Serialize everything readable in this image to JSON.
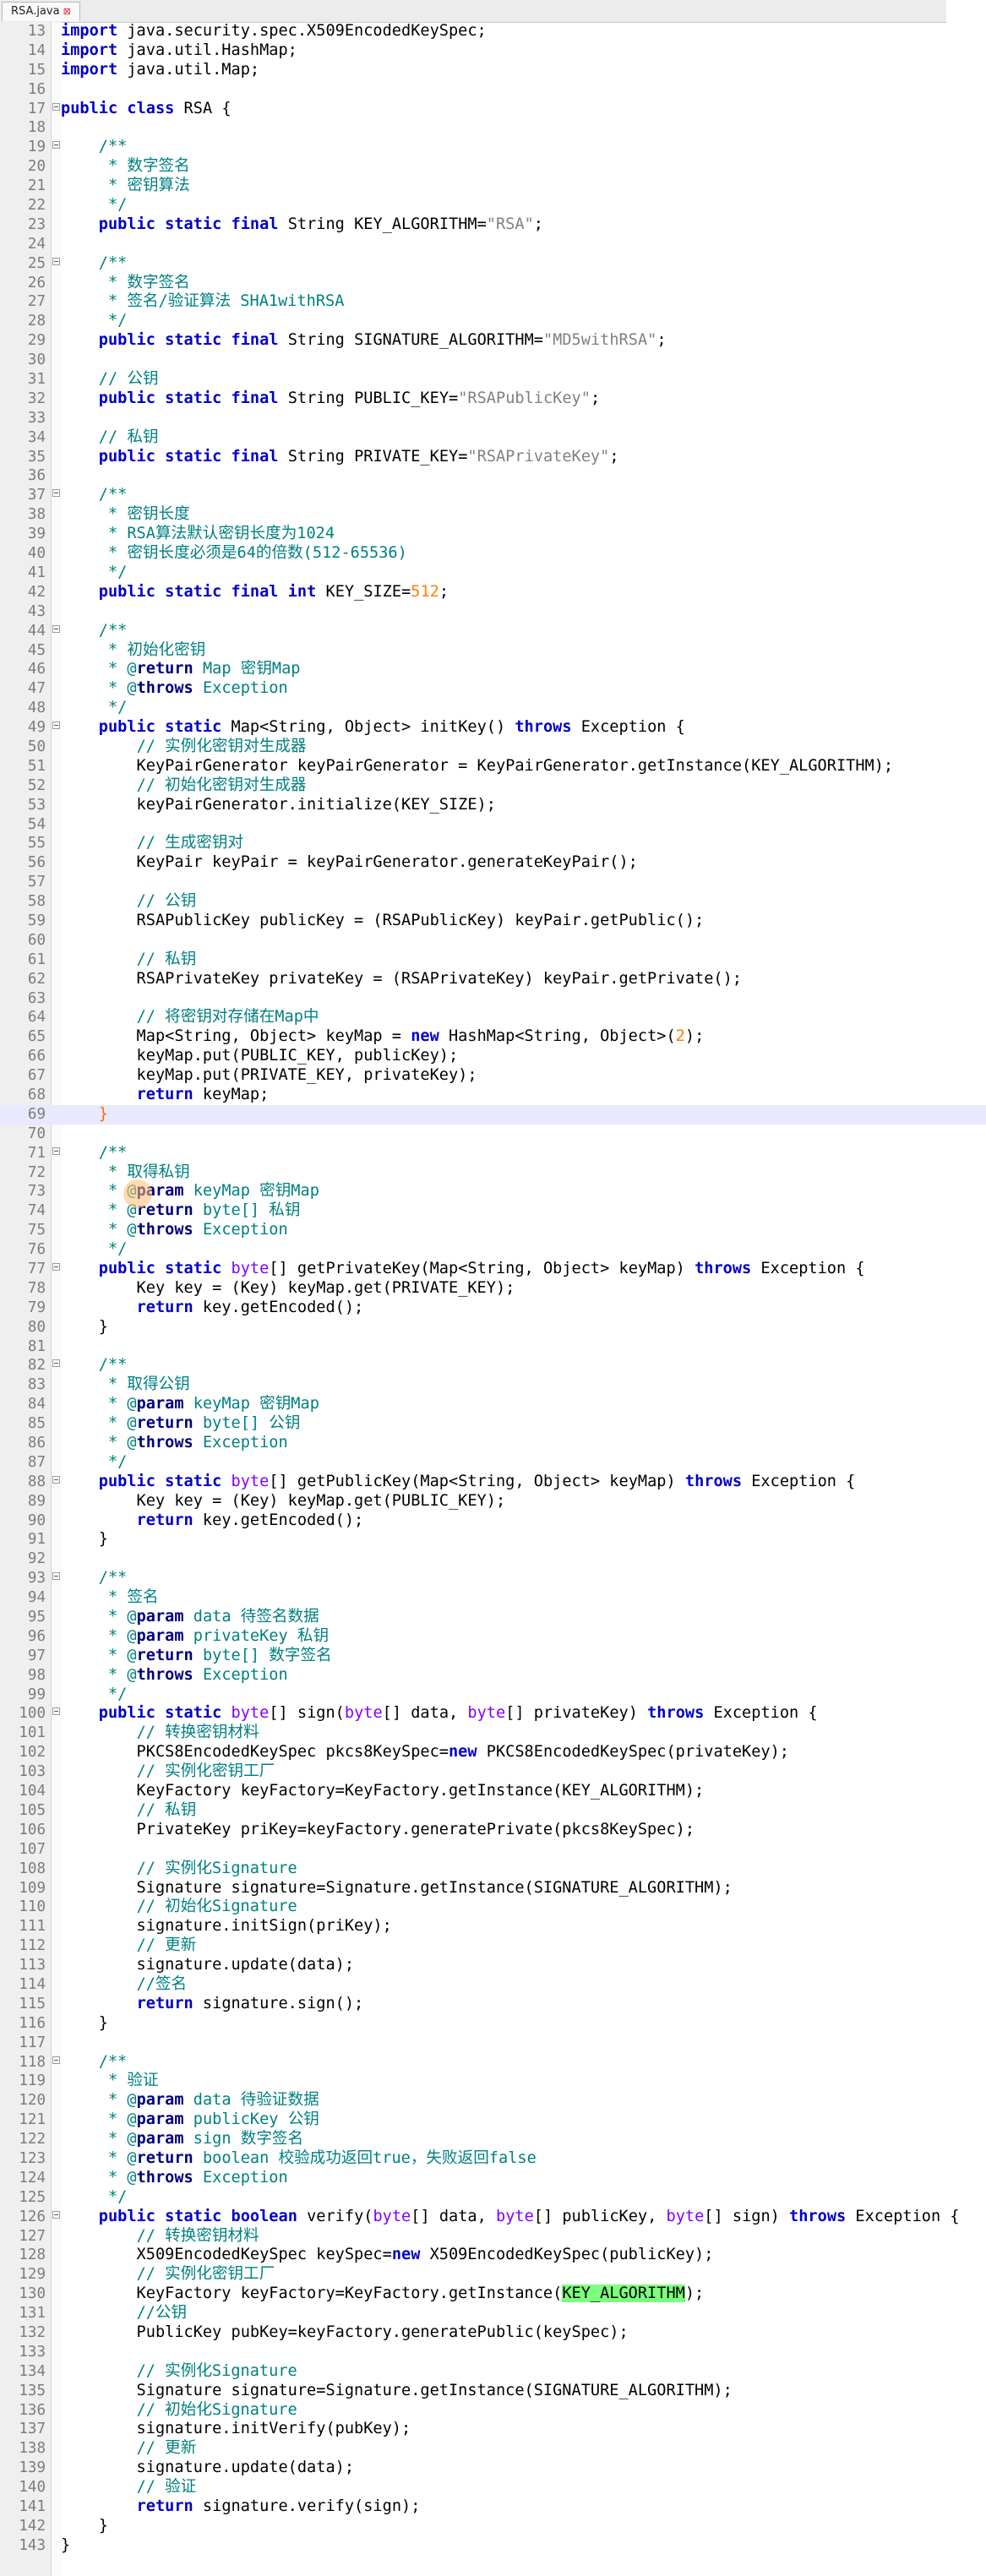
{
  "tab": {
    "label": "RSA.java",
    "close_glyph": "⊠"
  },
  "colors": {
    "keyword": "#0000c8",
    "comment": "#008080",
    "string": "#808080",
    "number": "#ff8000",
    "type": "#8000ff",
    "highlight": "#7cff7c",
    "current_line": "#e8e8ff"
  },
  "lines": [
    {
      "n": "13",
      "t": "import java.security.spec.X509EncodedKeySpec;"
    },
    {
      "n": "14",
      "t": "import java.util.HashMap;"
    },
    {
      "n": "15",
      "t": "import java.util.Map;"
    },
    {
      "n": "16",
      "t": ""
    },
    {
      "n": "17",
      "t": "public class RSA {",
      "fold": true
    },
    {
      "n": "18",
      "t": ""
    },
    {
      "n": "19",
      "t": "    /**",
      "fold": true
    },
    {
      "n": "20",
      "t": "     * 数字签名"
    },
    {
      "n": "21",
      "t": "     * 密钥算法"
    },
    {
      "n": "22",
      "t": "     */"
    },
    {
      "n": "23",
      "t": "    public static final String KEY_ALGORITHM=\"RSA\";"
    },
    {
      "n": "24",
      "t": ""
    },
    {
      "n": "25",
      "t": "    /**",
      "fold": true
    },
    {
      "n": "26",
      "t": "     * 数字签名"
    },
    {
      "n": "27",
      "t": "     * 签名/验证算法 SHA1withRSA"
    },
    {
      "n": "28",
      "t": "     */"
    },
    {
      "n": "29",
      "t": "    public static final String SIGNATURE_ALGORITHM=\"MD5withRSA\";"
    },
    {
      "n": "30",
      "t": ""
    },
    {
      "n": "31",
      "t": "    // 公钥"
    },
    {
      "n": "32",
      "t": "    public static final String PUBLIC_KEY=\"RSAPublicKey\";"
    },
    {
      "n": "33",
      "t": ""
    },
    {
      "n": "34",
      "t": "    // 私钥"
    },
    {
      "n": "35",
      "t": "    public static final String PRIVATE_KEY=\"RSAPrivateKey\";"
    },
    {
      "n": "36",
      "t": ""
    },
    {
      "n": "37",
      "t": "    /**",
      "fold": true
    },
    {
      "n": "38",
      "t": "     * 密钥长度"
    },
    {
      "n": "39",
      "t": "     * RSA算法默认密钥长度为1024"
    },
    {
      "n": "40",
      "t": "     * 密钥长度必须是64的倍数(512-65536)"
    },
    {
      "n": "41",
      "t": "     */"
    },
    {
      "n": "42",
      "t": "    public static final int KEY_SIZE=512;"
    },
    {
      "n": "43",
      "t": ""
    },
    {
      "n": "44",
      "t": "    /**",
      "fold": true
    },
    {
      "n": "45",
      "t": "     * 初始化密钥"
    },
    {
      "n": "46",
      "t": "     * @return Map 密钥Map"
    },
    {
      "n": "47",
      "t": "     * @throws Exception"
    },
    {
      "n": "48",
      "t": "     */"
    },
    {
      "n": "49",
      "t": "    public static Map<String, Object> initKey() throws Exception {",
      "fold": true
    },
    {
      "n": "50",
      "t": "        // 实例化密钥对生成器"
    },
    {
      "n": "51",
      "t": "        KeyPairGenerator keyPairGenerator = KeyPairGenerator.getInstance(KEY_ALGORITHM);"
    },
    {
      "n": "52",
      "t": "        // 初始化密钥对生成器"
    },
    {
      "n": "53",
      "t": "        keyPairGenerator.initialize(KEY_SIZE);"
    },
    {
      "n": "54",
      "t": ""
    },
    {
      "n": "55",
      "t": "        // 生成密钥对"
    },
    {
      "n": "56",
      "t": "        KeyPair keyPair = keyPairGenerator.generateKeyPair();"
    },
    {
      "n": "57",
      "t": ""
    },
    {
      "n": "58",
      "t": "        // 公钥"
    },
    {
      "n": "59",
      "t": "        RSAPublicKey publicKey = (RSAPublicKey) keyPair.getPublic();"
    },
    {
      "n": "60",
      "t": ""
    },
    {
      "n": "61",
      "t": "        // 私钥"
    },
    {
      "n": "62",
      "t": "        RSAPrivateKey privateKey = (RSAPrivateKey) keyPair.getPrivate();"
    },
    {
      "n": "63",
      "t": ""
    },
    {
      "n": "64",
      "t": "        // 将密钥对存储在Map中"
    },
    {
      "n": "65",
      "t": "        Map<String, Object> keyMap = new HashMap<String, Object>(2);"
    },
    {
      "n": "66",
      "t": "        keyMap.put(PUBLIC_KEY, publicKey);"
    },
    {
      "n": "67",
      "t": "        keyMap.put(PRIVATE_KEY, privateKey);"
    },
    {
      "n": "68",
      "t": "        return keyMap;"
    },
    {
      "n": "69",
      "t": "    }",
      "current": true
    },
    {
      "n": "70",
      "t": ""
    },
    {
      "n": "71",
      "t": "    /**",
      "fold": true
    },
    {
      "n": "72",
      "t": "     * 取得私钥"
    },
    {
      "n": "73",
      "t": "     * @param keyMap 密钥Map"
    },
    {
      "n": "74",
      "t": "     * @return byte[] 私钥"
    },
    {
      "n": "75",
      "t": "     * @throws Exception"
    },
    {
      "n": "76",
      "t": "     */"
    },
    {
      "n": "77",
      "t": "    public static byte[] getPrivateKey(Map<String, Object> keyMap) throws Exception {",
      "fold": true
    },
    {
      "n": "78",
      "t": "        Key key = (Key) keyMap.get(PRIVATE_KEY);"
    },
    {
      "n": "79",
      "t": "        return key.getEncoded();"
    },
    {
      "n": "80",
      "t": "    }"
    },
    {
      "n": "81",
      "t": ""
    },
    {
      "n": "82",
      "t": "    /**",
      "fold": true
    },
    {
      "n": "83",
      "t": "     * 取得公钥"
    },
    {
      "n": "84",
      "t": "     * @param keyMap 密钥Map"
    },
    {
      "n": "85",
      "t": "     * @return byte[] 公钥"
    },
    {
      "n": "86",
      "t": "     * @throws Exception"
    },
    {
      "n": "87",
      "t": "     */"
    },
    {
      "n": "88",
      "t": "    public static byte[] getPublicKey(Map<String, Object> keyMap) throws Exception {",
      "fold": true
    },
    {
      "n": "89",
      "t": "        Key key = (Key) keyMap.get(PUBLIC_KEY);"
    },
    {
      "n": "90",
      "t": "        return key.getEncoded();"
    },
    {
      "n": "91",
      "t": "    }"
    },
    {
      "n": "92",
      "t": ""
    },
    {
      "n": "93",
      "t": "    /**",
      "fold": true
    },
    {
      "n": "94",
      "t": "     * 签名"
    },
    {
      "n": "95",
      "t": "     * @param data 待签名数据"
    },
    {
      "n": "96",
      "t": "     * @param privateKey 私钥"
    },
    {
      "n": "97",
      "t": "     * @return byte[] 数字签名"
    },
    {
      "n": "98",
      "t": "     * @throws Exception"
    },
    {
      "n": "99",
      "t": "     */"
    },
    {
      "n": "100",
      "t": "    public static byte[] sign(byte[] data, byte[] privateKey) throws Exception {",
      "fold": true
    },
    {
      "n": "101",
      "t": "        // 转换密钥材料"
    },
    {
      "n": "102",
      "t": "        PKCS8EncodedKeySpec pkcs8KeySpec=new PKCS8EncodedKeySpec(privateKey);"
    },
    {
      "n": "103",
      "t": "        // 实例化密钥工厂"
    },
    {
      "n": "104",
      "t": "        KeyFactory keyFactory=KeyFactory.getInstance(KEY_ALGORITHM);"
    },
    {
      "n": "105",
      "t": "        // 私钥"
    },
    {
      "n": "106",
      "t": "        PrivateKey priKey=keyFactory.generatePrivate(pkcs8KeySpec);"
    },
    {
      "n": "107",
      "t": ""
    },
    {
      "n": "108",
      "t": "        // 实例化Signature"
    },
    {
      "n": "109",
      "t": "        Signature signature=Signature.getInstance(SIGNATURE_ALGORITHM);"
    },
    {
      "n": "110",
      "t": "        // 初始化Signature"
    },
    {
      "n": "111",
      "t": "        signature.initSign(priKey);"
    },
    {
      "n": "112",
      "t": "        // 更新"
    },
    {
      "n": "113",
      "t": "        signature.update(data);"
    },
    {
      "n": "114",
      "t": "        //签名"
    },
    {
      "n": "115",
      "t": "        return signature.sign();"
    },
    {
      "n": "116",
      "t": "    }"
    },
    {
      "n": "117",
      "t": ""
    },
    {
      "n": "118",
      "t": "    /**",
      "fold": true
    },
    {
      "n": "119",
      "t": "     * 验证"
    },
    {
      "n": "120",
      "t": "     * @param data 待验证数据"
    },
    {
      "n": "121",
      "t": "     * @param publicKey 公钥"
    },
    {
      "n": "122",
      "t": "     * @param sign 数字签名"
    },
    {
      "n": "123",
      "t": "     * @return boolean 校验成功返回true，失败返回false"
    },
    {
      "n": "124",
      "t": "     * @throws Exception"
    },
    {
      "n": "125",
      "t": "     */"
    },
    {
      "n": "126",
      "t": "    public static boolean verify(byte[] data, byte[] publicKey, byte[] sign) throws Exception {",
      "fold": true
    },
    {
      "n": "127",
      "t": "        // 转换密钥材料"
    },
    {
      "n": "128",
      "t": "        X509EncodedKeySpec keySpec=new X509EncodedKeySpec(publicKey);"
    },
    {
      "n": "129",
      "t": "        // 实例化密钥工厂"
    },
    {
      "n": "130",
      "t": "        KeyFactory keyFactory=KeyFactory.getInstance(KEY_ALGORITHM);",
      "hl": "KEY_ALGORITHM"
    },
    {
      "n": "131",
      "t": "        //公钥"
    },
    {
      "n": "132",
      "t": "        PublicKey pubKey=keyFactory.generatePublic(keySpec);"
    },
    {
      "n": "133",
      "t": ""
    },
    {
      "n": "134",
      "t": "        // 实例化Signature"
    },
    {
      "n": "135",
      "t": "        Signature signature=Signature.getInstance(SIGNATURE_ALGORITHM);"
    },
    {
      "n": "136",
      "t": "        // 初始化Signature"
    },
    {
      "n": "137",
      "t": "        signature.initVerify(pubKey);"
    },
    {
      "n": "138",
      "t": "        // 更新"
    },
    {
      "n": "139",
      "t": "        signature.update(data);"
    },
    {
      "n": "140",
      "t": "        // 验证"
    },
    {
      "n": "141",
      "t": "        return signature.verify(sign);"
    },
    {
      "n": "142",
      "t": "    }"
    },
    {
      "n": "143",
      "t": "}"
    }
  ]
}
